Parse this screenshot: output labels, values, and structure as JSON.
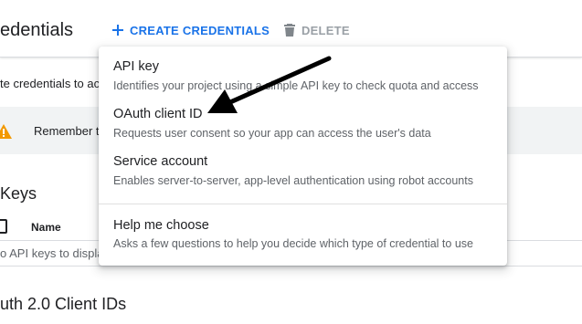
{
  "header": {
    "title": "edentials",
    "create_label": "CREATE CREDENTIALS",
    "delete_label": "DELETE",
    "create_icon": "plus-icon",
    "delete_icon": "trash-icon"
  },
  "content": {
    "intro": "te credentials to acc",
    "banner_text": "Remember t",
    "api_keys_title": "Keys",
    "name_column": "Name",
    "empty_text": "o API keys to displa",
    "oauth_title": "uth 2.0 Client IDs"
  },
  "menu": {
    "items": [
      {
        "label": "API key",
        "description": "Identifies your project using a simple API key to check quota and access"
      },
      {
        "label": "OAuth client ID",
        "description": "Requests user consent so your app can access the user's data"
      },
      {
        "label": "Service account",
        "description": "Enables server-to-server, app-level authentication using robot accounts"
      },
      {
        "label": "Help me choose",
        "description": "Asks a few questions to help you decide which type of credential to use"
      }
    ]
  },
  "colors": {
    "accent": "#1a73e8",
    "warning": "#f29900",
    "disabled": "#9aa0a6"
  }
}
